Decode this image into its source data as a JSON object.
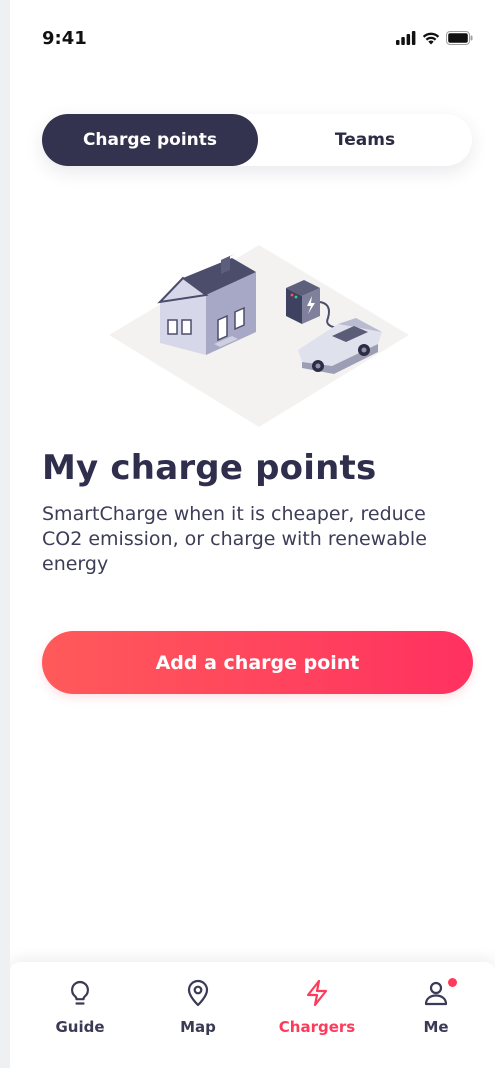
{
  "status_bar": {
    "time": "9:41",
    "icons": [
      "cellular-signal-icon",
      "wifi-icon",
      "battery-icon"
    ]
  },
  "segmented_control": {
    "tabs": [
      {
        "label": "Charge points",
        "selected": true
      },
      {
        "label": "Teams",
        "selected": false
      }
    ]
  },
  "empty_state": {
    "illustration": "house-charger-car-illustration",
    "title": "My charge points",
    "description": "SmartCharge when it is cheaper, reduce CO2 emission, or charge with renewable energy"
  },
  "primary_action": {
    "label": "Add a charge point"
  },
  "tab_bar": {
    "items": [
      {
        "label": "Guide",
        "icon": "lightbulb-icon",
        "active": false
      },
      {
        "label": "Map",
        "icon": "map-pin-icon",
        "active": false
      },
      {
        "label": "Chargers",
        "icon": "lightning-bolt-icon",
        "active": true
      },
      {
        "label": "Me",
        "icon": "person-icon",
        "active": false,
        "badge": true
      }
    ]
  },
  "colors": {
    "primary_dark": "#33334f",
    "accent": "#ff3b5c",
    "gradient_start": "#ff5a5a",
    "gradient_end": "#ff3160",
    "text_dark": "#2f2f4d"
  }
}
